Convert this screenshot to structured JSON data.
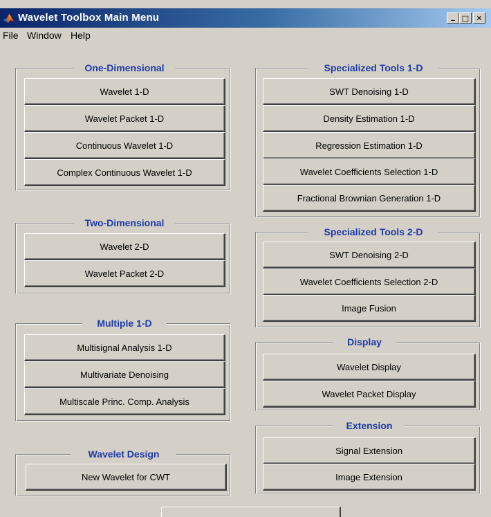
{
  "window": {
    "title": "Wavelet Toolbox Main Menu",
    "icon": "matlab-logo-icon",
    "controls": {
      "minimize": "_",
      "maximize": "□",
      "close": "✕"
    }
  },
  "menubar": {
    "items": [
      "File",
      "Window",
      "Help"
    ]
  },
  "panels": {
    "one_d": {
      "title": "One-Dimensional",
      "buttons": [
        "Wavelet 1-D",
        "Wavelet Packet 1-D",
        "Continuous Wavelet 1-D",
        "Complex Continuous Wavelet 1-D"
      ]
    },
    "two_d": {
      "title": "Two-Dimensional",
      "buttons": [
        "Wavelet 2-D",
        "Wavelet Packet 2-D"
      ]
    },
    "multiple_1d": {
      "title": "Multiple 1-D",
      "buttons": [
        "Multisignal Analysis 1-D",
        "Multivariate Denoising",
        "Multiscale Princ. Comp. Analysis"
      ]
    },
    "wavelet_design": {
      "title": "Wavelet Design",
      "buttons": [
        "New Wavelet for CWT"
      ]
    },
    "spec_1d": {
      "title": "Specialized Tools 1-D",
      "buttons": [
        "SWT Denoising 1-D",
        "Density Estimation 1-D",
        "Regression Estimation 1-D",
        "Wavelet Coefficients Selection 1-D",
        "Fractional Brownian Generation 1-D"
      ]
    },
    "spec_2d": {
      "title": "Specialized Tools 2-D",
      "buttons": [
        "SWT Denoising 2-D",
        "Wavelet Coefficients Selection 2-D",
        "Image Fusion"
      ]
    },
    "display": {
      "title": "Display",
      "buttons": [
        "Wavelet Display",
        "Wavelet Packet Display"
      ]
    },
    "extension": {
      "title": "Extension",
      "buttons": [
        "Signal Extension",
        "Image Extension"
      ]
    }
  },
  "colors": {
    "face": "#d4d0c8",
    "legend": "#1c3aa9",
    "title_start": "#0a246a",
    "title_end": "#a6caf0"
  }
}
